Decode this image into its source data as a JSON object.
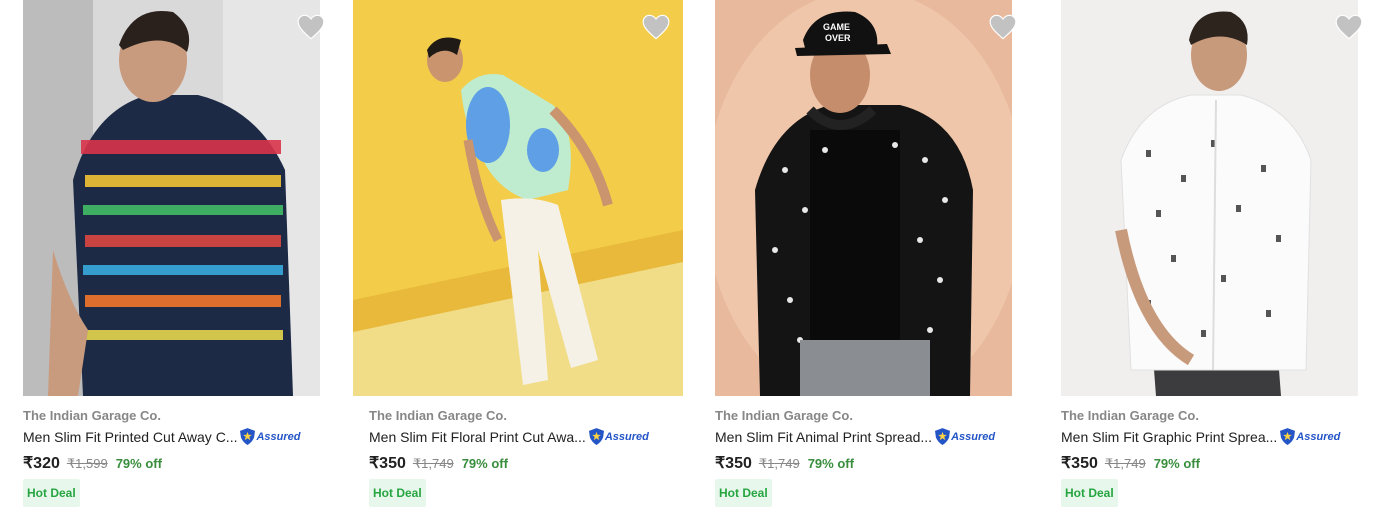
{
  "products": [
    {
      "brand": "The Indian Garage Co.",
      "title": "Men Slim Fit Printed Cut Away C...",
      "assured": "Assured",
      "price": "₹320",
      "mrp": "₹1,599",
      "discount": "79% off",
      "badge": "Hot Deal",
      "image": "man-in-multicolor-printed-shirt-photo"
    },
    {
      "brand": "The Indian Garage Co.",
      "title": "Men Slim Fit Floral Print Cut Awa...",
      "assured": "Assured",
      "price": "₹350",
      "mrp": "₹1,749",
      "discount": "79% off",
      "badge": "Hot Deal",
      "image": "man-in-mint-floral-shirt-photo"
    },
    {
      "brand": "The Indian Garage Co.",
      "title": "Men Slim Fit Animal Print Spread...",
      "assured": "Assured",
      "price": "₹350",
      "mrp": "₹1,749",
      "discount": "79% off",
      "badge": "Hot Deal",
      "image": "man-in-black-animal-print-shirt-photo"
    },
    {
      "brand": "The Indian Garage Co.",
      "title": "Men Slim Fit Graphic Print Sprea...",
      "assured": "Assured",
      "price": "₹350",
      "mrp": "₹1,749",
      "discount": "79% off",
      "badge": "Hot Deal",
      "image": "man-in-white-graphic-print-shirt-photo"
    }
  ],
  "icons": {
    "wishlist": "heart-icon",
    "assured": "assured-shield-icon"
  },
  "colors": {
    "discount": "#388e3c",
    "badge_bg": "#e8f7ec",
    "badge_text": "#26a541",
    "assured": "#2455c7",
    "heart": "#c2c2c2"
  }
}
